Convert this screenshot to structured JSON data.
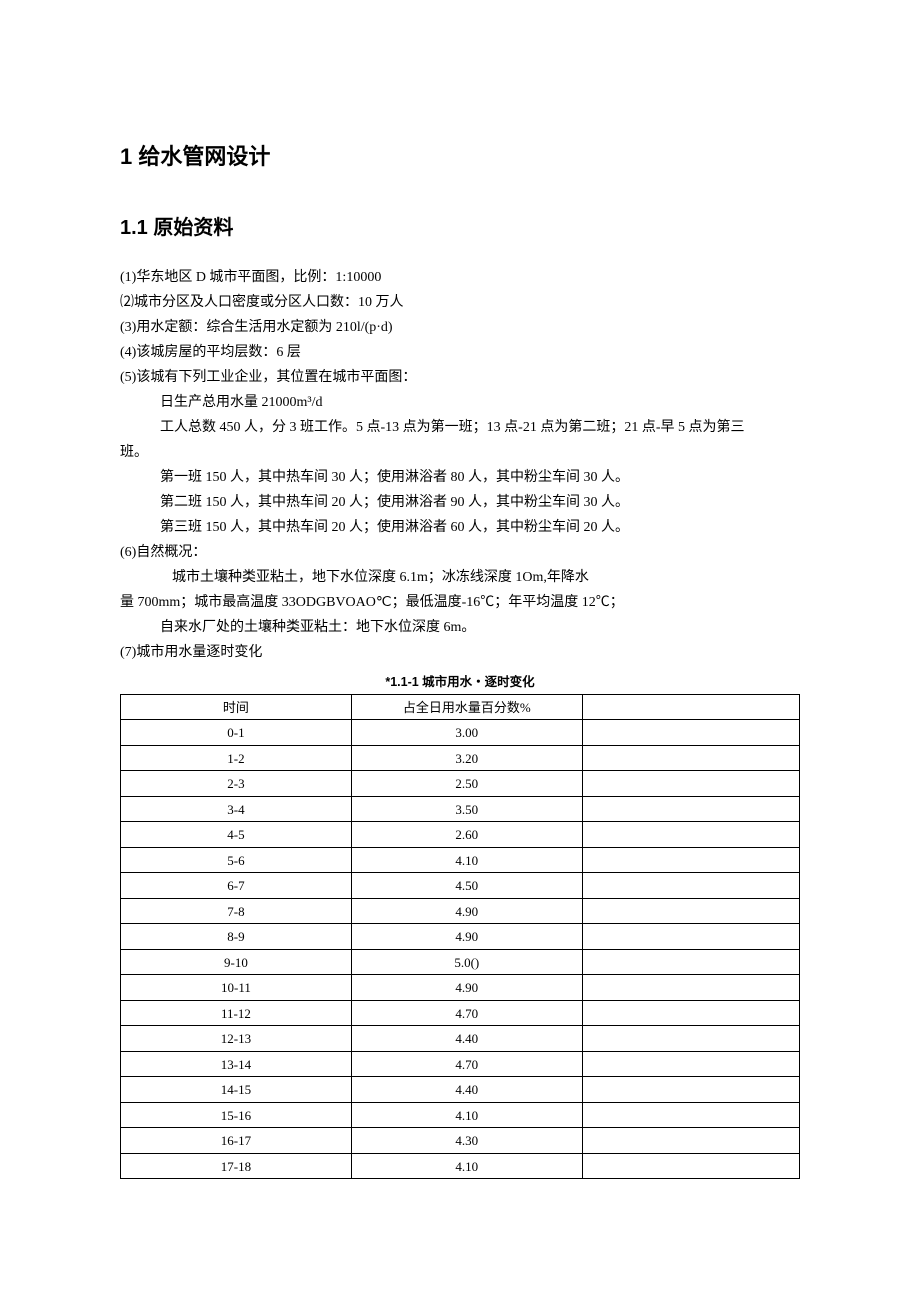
{
  "h1": "1 给水管网设计",
  "h2": "1.1 原始资料",
  "lines": {
    "l1": "(1)华东地区 D 城市平面图，比例：1:10000",
    "l2": "⑵城市分区及人口密度或分区人口数：10 万人",
    "l3": "(3)用水定额：综合生活用水定额为 210l/(p·d)",
    "l4": "(4)该城房屋的平均层数：6 层",
    "l5": "(5)该城有下列工业企业，其位置在城市平面图：",
    "l6": "日生产总用水量 21000m³/d",
    "l7a": "工人总数 450 人，分 3 班工作。5 点-13 点为第一班；13 点-21 点为第二班；21 点-早 5 点为第三",
    "l7b": "班。",
    "l8": "第一班 150 人，其中热车间 30 人；使用淋浴者 80 人，其中粉尘车间 30 人。",
    "l9": "第二班 150 人，其中热车间 20 人；使用淋浴者 90 人，其中粉尘车间 30 人。",
    "l10": "第三班 150 人，其中热车间 20 人；使用淋浴者 60 人，其中粉尘车间 20 人。",
    "l11": "(6)自然概况：",
    "l12": "城市土壤种类亚粘土，地下水位深度 6.1m；冰冻线深度 1Om,年降水",
    "l13": "量 700mm；城市最高温度 33ODGBVOAO℃；最低温度-16℃；年平均温度 12℃；",
    "l14": "自来水厂处的土壤种类亚粘土：地下水位深度 6m。",
    "l15": "  (7)城市用水量逐时变化"
  },
  "table_caption": "*1.1-1 城市用水・逐时变化",
  "chart_data": {
    "type": "table",
    "title": "*1.1-1 城市用水・逐时变化",
    "columns": [
      "时间",
      "占全日用水量百分数%",
      ""
    ],
    "rows": [
      [
        "0-1",
        "3.00",
        ""
      ],
      [
        "1-2",
        "3.20",
        ""
      ],
      [
        "2-3",
        "2.50",
        ""
      ],
      [
        "3-4",
        "3.50",
        ""
      ],
      [
        "4-5",
        "2.60",
        ""
      ],
      [
        "5-6",
        "4.10",
        ""
      ],
      [
        "6-7",
        "4.50",
        ""
      ],
      [
        "7-8",
        "4.90",
        ""
      ],
      [
        "8-9",
        "4.90",
        ""
      ],
      [
        "9-10",
        "5.0()",
        ""
      ],
      [
        "10-11",
        "4.90",
        ""
      ],
      [
        "11-12",
        "4.70",
        ""
      ],
      [
        "12-13",
        "4.40",
        ""
      ],
      [
        "13-14",
        "4.70",
        ""
      ],
      [
        "14-15",
        "4.40",
        ""
      ],
      [
        "15-16",
        "4.10",
        ""
      ],
      [
        "16-17",
        "4.30",
        ""
      ],
      [
        "17-18",
        "4.10",
        ""
      ]
    ]
  }
}
